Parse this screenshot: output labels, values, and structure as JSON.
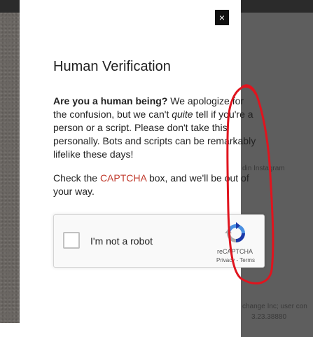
{
  "modal": {
    "close_label": "×",
    "title": "Human Verification",
    "intro_bold": "Are you a human being?",
    "intro_line1_rest": " We apologize for",
    "intro_line2_a": "the confusion, but we can't ",
    "intro_line2_em": "quite",
    "intro_line2_b": " tell if you're a",
    "intro_line3": "person or a script. Please don't take this",
    "intro_line4": "personally. Bots and scripts can be remarkably",
    "intro_line5": "lifelike these days!",
    "check_prefix": "Check the ",
    "check_link": "CAPTCHA",
    "check_suffix_line1": " box, and we'll be out of",
    "check_line2": "your way."
  },
  "recaptcha": {
    "label": "I'm not a robot",
    "brand": "reCAPTCHA",
    "privacy": "Privacy",
    "separator": " - ",
    "terms": "Terms"
  },
  "background": {
    "social_text": "din  Instagram",
    "footer_line1": "change Inc; user con",
    "footer_line2": "3.23.38880"
  },
  "colors": {
    "link": "#c0392b",
    "annotation": "#e0141e",
    "overlay": "#5e5e5e"
  }
}
